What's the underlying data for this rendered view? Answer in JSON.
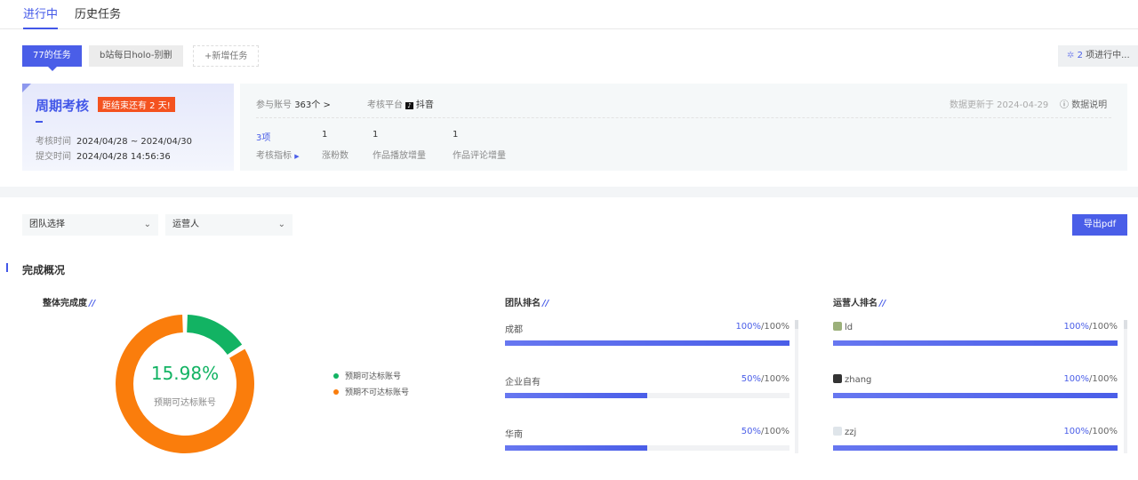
{
  "tabs": [
    "进行中",
    "历史任务"
  ],
  "task_chips": [
    "77的任务",
    "b站每日holo-别删",
    "+新增任务"
  ],
  "running": {
    "count": "2",
    "label": " 项进行中..."
  },
  "period": {
    "title": "周期考核",
    "badge": "距结束还有 2 天!",
    "time_label": "考核时间",
    "time_value": "2024/04/28 ~ 2024/04/30",
    "submit_label": "提交时间",
    "submit_value": "2024/04/28 14:56:36"
  },
  "info": {
    "accounts_label": "参与账号",
    "accounts_value": "363个 >",
    "platform_label": "考核平台",
    "platform_value": "抖音",
    "updated": "数据更新于 2024-04-29",
    "explain": "数据说明",
    "metric_count": "3项",
    "metric_label": "考核指标",
    "metrics": [
      {
        "value": "1",
        "label": "涨粉数"
      },
      {
        "value": "1",
        "label": "作品播放增量"
      },
      {
        "value": "1",
        "label": "作品评论增量"
      }
    ]
  },
  "filters": {
    "team": "团队选择",
    "operator": "运营人",
    "export": "导出pdf"
  },
  "section_title": "完成概况",
  "overall": {
    "title": "整体完成度",
    "percent": "15.98%",
    "center_label": "预期可达标账号",
    "fraction": 0.1598,
    "legend": [
      {
        "label": "预期可达标账号",
        "color": "#12b363"
      },
      {
        "label": "预期不可达标账号",
        "color": "#fa7d0c"
      }
    ]
  },
  "team_rank": {
    "title": "团队排名",
    "rows": [
      {
        "name": "成都",
        "done": "100%",
        "total": "/100%",
        "progress": 1.0
      },
      {
        "name": "企业自有",
        "done": "50%",
        "total": "/100%",
        "progress": 0.5
      },
      {
        "name": "华南",
        "done": "50%",
        "total": "/100%",
        "progress": 0.5
      }
    ]
  },
  "operator_rank": {
    "title": "运营人排名",
    "rows": [
      {
        "name": "ld",
        "done": "100%",
        "total": "/100%",
        "progress": 1.0
      },
      {
        "name": "zhang",
        "done": "100%",
        "total": "/100%",
        "progress": 1.0
      },
      {
        "name": "zzj",
        "done": "100%",
        "total": "/100%",
        "progress": 1.0
      }
    ]
  }
}
